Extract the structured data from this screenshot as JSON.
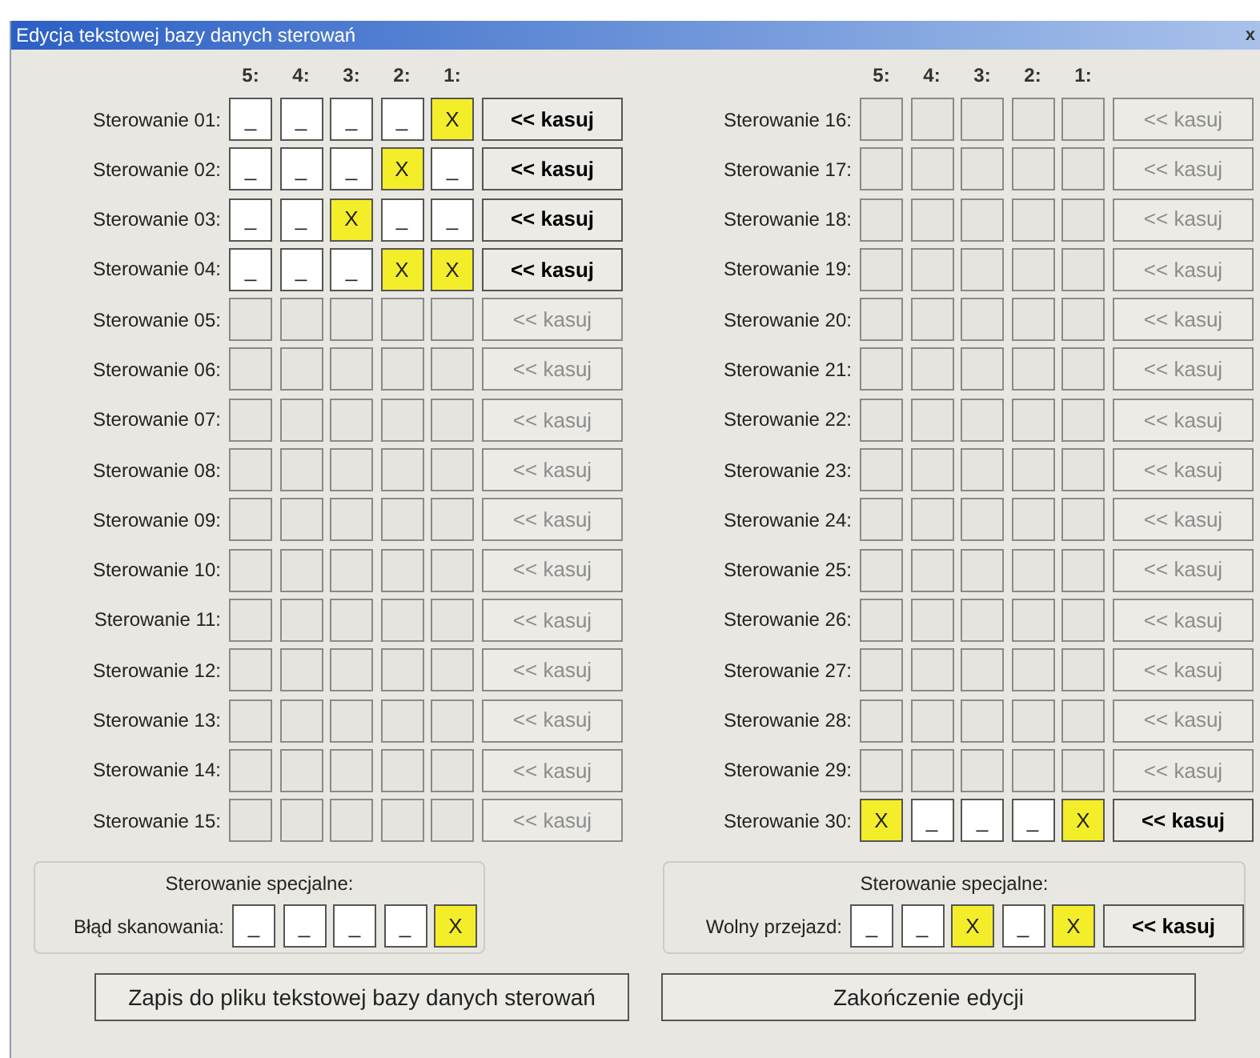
{
  "window": {
    "title": "Edycja tekstowej bazy danych sterowań",
    "close_button": "x"
  },
  "panels": [
    {
      "column_headers": [
        "5:",
        "4:",
        "3:",
        "2:",
        "1:"
      ],
      "rows": [
        {
          "label": "Sterowanie 01:",
          "disabled": false,
          "cells": [
            {
              "text": "_",
              "checked": false
            },
            {
              "text": "_",
              "checked": false
            },
            {
              "text": "_",
              "checked": false
            },
            {
              "text": "_",
              "checked": false
            },
            {
              "text": "X",
              "checked": true
            }
          ],
          "button": "<< kasuj"
        },
        {
          "label": "Sterowanie 02:",
          "disabled": false,
          "cells": [
            {
              "text": "_",
              "checked": false
            },
            {
              "text": "_",
              "checked": false
            },
            {
              "text": "_",
              "checked": false
            },
            {
              "text": "X",
              "checked": true
            },
            {
              "text": "_",
              "checked": false
            }
          ],
          "button": "<< kasuj"
        },
        {
          "label": "Sterowanie 03:",
          "disabled": false,
          "cells": [
            {
              "text": "_",
              "checked": false
            },
            {
              "text": "_",
              "checked": false
            },
            {
              "text": "X",
              "checked": true
            },
            {
              "text": "_",
              "checked": false
            },
            {
              "text": "_",
              "checked": false
            }
          ],
          "button": "<< kasuj"
        },
        {
          "label": "Sterowanie 04:",
          "disabled": false,
          "cells": [
            {
              "text": "_",
              "checked": false
            },
            {
              "text": "_",
              "checked": false
            },
            {
              "text": "_",
              "checked": false
            },
            {
              "text": "X",
              "checked": true
            },
            {
              "text": "X",
              "checked": true
            }
          ],
          "button": "<< kasuj"
        },
        {
          "label": "Sterowanie 05:",
          "disabled": true,
          "button": "<< kasuj"
        },
        {
          "label": "Sterowanie 06:",
          "disabled": true,
          "button": "<< kasuj"
        },
        {
          "label": "Sterowanie 07:",
          "disabled": true,
          "button": "<< kasuj"
        },
        {
          "label": "Sterowanie 08:",
          "disabled": true,
          "button": "<< kasuj"
        },
        {
          "label": "Sterowanie 09:",
          "disabled": true,
          "button": "<< kasuj"
        },
        {
          "label": "Sterowanie 10:",
          "disabled": true,
          "button": "<< kasuj"
        },
        {
          "label": "Sterowanie 11:",
          "disabled": true,
          "button": "<< kasuj"
        },
        {
          "label": "Sterowanie 12:",
          "disabled": true,
          "button": "<< kasuj"
        },
        {
          "label": "Sterowanie 13:",
          "disabled": true,
          "button": "<< kasuj"
        },
        {
          "label": "Sterowanie 14:",
          "disabled": true,
          "button": "<< kasuj"
        },
        {
          "label": "Sterowanie 15:",
          "disabled": true,
          "button": "<< kasuj"
        }
      ],
      "special": {
        "title": "Sterowanie specjalne:",
        "label": "Błąd skanowania:",
        "cells": [
          {
            "text": "_",
            "checked": false
          },
          {
            "text": "_",
            "checked": false
          },
          {
            "text": "_",
            "checked": false
          },
          {
            "text": "_",
            "checked": false
          },
          {
            "text": "X",
            "checked": true
          }
        ]
      }
    },
    {
      "column_headers": [
        "5:",
        "4:",
        "3:",
        "2:",
        "1:"
      ],
      "rows": [
        {
          "label": "Sterowanie 16:",
          "disabled": true,
          "button": "<< kasuj"
        },
        {
          "label": "Sterowanie 17:",
          "disabled": true,
          "button": "<< kasuj"
        },
        {
          "label": "Sterowanie 18:",
          "disabled": true,
          "button": "<< kasuj"
        },
        {
          "label": "Sterowanie 19:",
          "disabled": true,
          "button": "<< kasuj"
        },
        {
          "label": "Sterowanie 20:",
          "disabled": true,
          "button": "<< kasuj"
        },
        {
          "label": "Sterowanie 21:",
          "disabled": true,
          "button": "<< kasuj"
        },
        {
          "label": "Sterowanie 22:",
          "disabled": true,
          "button": "<< kasuj"
        },
        {
          "label": "Sterowanie 23:",
          "disabled": true,
          "button": "<< kasuj"
        },
        {
          "label": "Sterowanie 24:",
          "disabled": true,
          "button": "<< kasuj"
        },
        {
          "label": "Sterowanie 25:",
          "disabled": true,
          "button": "<< kasuj"
        },
        {
          "label": "Sterowanie 26:",
          "disabled": true,
          "button": "<< kasuj"
        },
        {
          "label": "Sterowanie 27:",
          "disabled": true,
          "button": "<< kasuj"
        },
        {
          "label": "Sterowanie 28:",
          "disabled": true,
          "button": "<< kasuj"
        },
        {
          "label": "Sterowanie 29:",
          "disabled": true,
          "button": "<< kasuj"
        },
        {
          "label": "Sterowanie 30:",
          "disabled": false,
          "cells": [
            {
              "text": "X",
              "checked": true
            },
            {
              "text": "_",
              "checked": false
            },
            {
              "text": "_",
              "checked": false
            },
            {
              "text": "_",
              "checked": false
            },
            {
              "text": "X",
              "checked": true
            }
          ],
          "button": "<< kasuj"
        }
      ],
      "special": {
        "title": "Sterowanie specjalne:",
        "label": "Wolny przejazd:",
        "cells": [
          {
            "text": "_",
            "checked": false
          },
          {
            "text": "_",
            "checked": false
          },
          {
            "text": "X",
            "checked": true
          },
          {
            "text": "_",
            "checked": false
          },
          {
            "text": "X",
            "checked": true
          }
        ],
        "button": "<< kasuj"
      }
    }
  ],
  "buttons": [
    {
      "label": "Zapis do pliku tekstowej bazy danych sterowań"
    },
    {
      "label": "Zakończenie edycji"
    }
  ]
}
